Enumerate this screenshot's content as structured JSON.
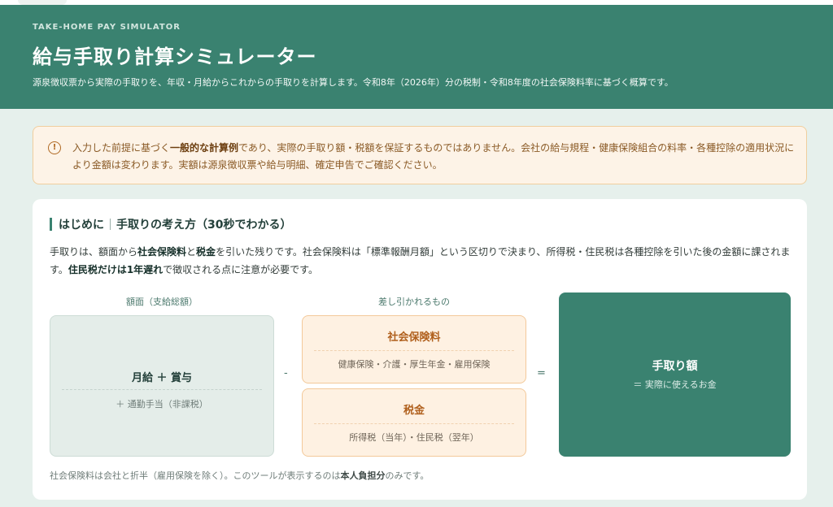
{
  "header": {
    "eyebrow": "TAKE-HOME PAY SIMULATOR",
    "title": "給与手取り計算シミュレーター",
    "subtitle": "源泉徴収票から実際の手取りを、年収・月給からこれからの手取りを計算します。令和8年（2026年）分の税制・令和8年度の社会保険料率に基づく概算です。"
  },
  "notice": {
    "icon": "warning-circle-icon",
    "icon_glyph": "!",
    "text_before": "入力した前提に基づく",
    "text_bold": "一般的な計算例",
    "text_after": "であり、実際の手取り額・税額を保証するものではありません。会社の給与規程・健康保険組合の料率・各種控除の適用状況により金額は変わります。実額は源泉徴収票や給与明細、確定申告でご確認ください。"
  },
  "intro_section": {
    "title_left": "はじめに",
    "title_right": "手取りの考え方（30秒でわかる）",
    "p1": "手取りは、額面から",
    "b1": "社会保険料",
    "p2": "と",
    "b2": "税金",
    "p3": "を引いた残りです。社会保険料は「標準報酬月額」という区切りで決まり、所得税・住民税は各種控除を引いた後の金額に課されます。",
    "b3": "住民税だけは1年遅れ",
    "p4": "で徴収される点に注意が必要です。"
  },
  "diagram": {
    "gross_label": "額面（支給総額）",
    "gross_main": "月給 ＋ 賞与",
    "gross_sub": "＋ 通勤手当（非課税）",
    "minus": "-",
    "deductions_label": "差し引かれるもの",
    "social_title": "社会保険料",
    "social_sub": "健康保険・介護・厚生年金・雇用保険",
    "tax_title": "税金",
    "tax_sub": "所得税（当年）・住民税（翌年）",
    "equals": "=",
    "net_title": "手取り額",
    "net_sub": "＝ 実際に使えるお金"
  },
  "footnote": {
    "text": "社会保険料は会社と折半（雇用保険を除く）。このツールが表示するのは",
    "bold": "本人負担分",
    "text_after": "のみです。"
  }
}
